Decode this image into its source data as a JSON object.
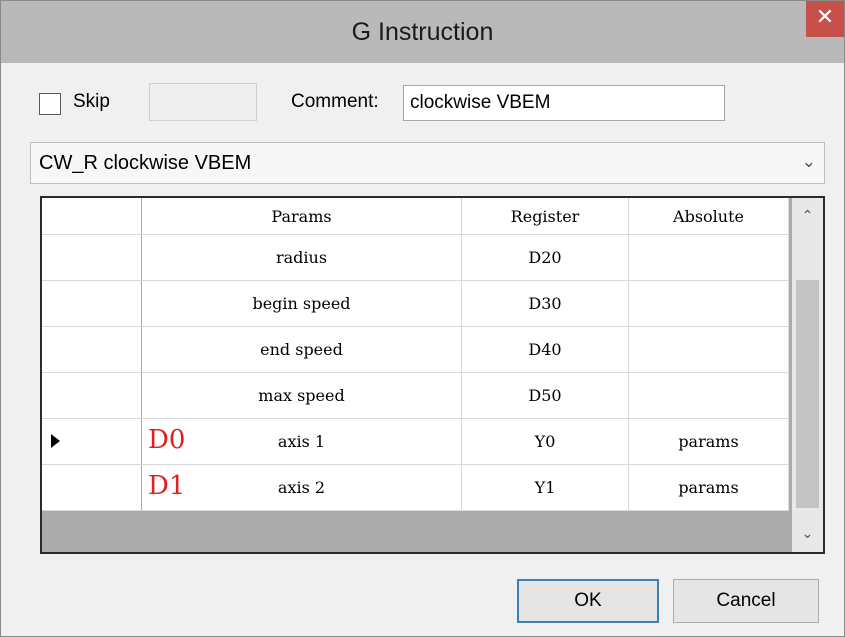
{
  "window": {
    "title": "G Instruction",
    "close_glyph": "✕"
  },
  "form": {
    "skip_label": "Skip",
    "skip_checked": false,
    "skip_field_value": "",
    "comment_label": "Comment:",
    "comment_value": "clockwise VBEM"
  },
  "instruction_select": {
    "selected": "CW_R clockwise VBEM",
    "arrow_glyph": "⌄"
  },
  "table": {
    "columns": [
      "Params",
      "Register",
      "Absolute"
    ],
    "rows": [
      {
        "label": "",
        "params": "radius",
        "register": "D20",
        "absolute": ""
      },
      {
        "label": "",
        "params": "begin speed",
        "register": "D30",
        "absolute": ""
      },
      {
        "label": "",
        "params": "end speed",
        "register": "D40",
        "absolute": ""
      },
      {
        "label": "",
        "params": "max speed",
        "register": "D50",
        "absolute": ""
      },
      {
        "label": "D0",
        "params": "axis 1",
        "register": "Y0",
        "absolute": "params",
        "current": true
      },
      {
        "label": "D1",
        "params": "axis 2",
        "register": "Y1",
        "absolute": "params"
      }
    ],
    "annotation_color": "#e02020"
  },
  "scrollbar": {
    "up_glyph": "⌃",
    "down_glyph": "⌄"
  },
  "buttons": {
    "ok_label": "OK",
    "cancel_label": "Cancel"
  },
  "colors": {
    "close_button": "#c7504a",
    "ok_border": "#3c7fb1",
    "title_bar": "#b9b9b9"
  }
}
